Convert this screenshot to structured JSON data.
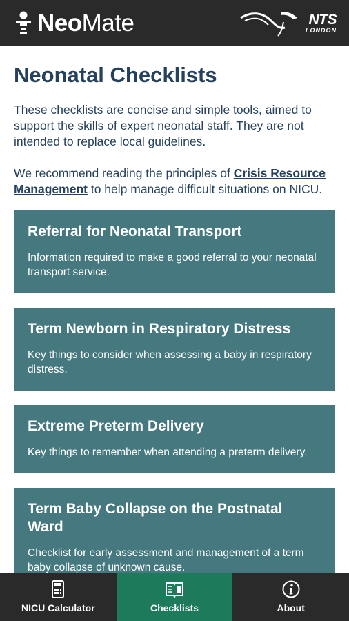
{
  "header": {
    "brand_bold": "Neo",
    "brand_rest": "Mate",
    "partner_name": "NTS",
    "partner_sub": "LONDON"
  },
  "page": {
    "title": "Neonatal Checklists",
    "intro": "These checklists are concise and simple tools, aimed to support the skills of expert neonatal staff. They are not intended to replace local guidelines.",
    "recommend_prefix": "We recommend reading the principles of ",
    "recommend_link": "Crisis Resource Management",
    "recommend_suffix": " to help manage difficult situations on NICU."
  },
  "checklists": [
    {
      "title": "Referral for Neonatal Transport",
      "description": "Information required to make a good referral to your neonatal transport service."
    },
    {
      "title": "Term Newborn in Respiratory Distress",
      "description": "Key things to consider when assessing a baby in respiratory distress."
    },
    {
      "title": "Extreme Preterm Delivery",
      "description": "Key things to remember when attending a preterm delivery."
    },
    {
      "title": "Term Baby Collapse on the Postnatal Ward",
      "description": "Checklist for early assessment and management of a term baby collapse of unknown cause."
    }
  ],
  "nav": {
    "items": [
      {
        "label": "NICU Calculator",
        "icon": "calculator-icon"
      },
      {
        "label": "Checklists",
        "icon": "checklist-book-icon",
        "active": true
      },
      {
        "label": "About",
        "icon": "info-icon"
      }
    ]
  },
  "colors": {
    "header_bg": "#2a2a2a",
    "title_color": "#26415c",
    "card_bg": "#46787f",
    "active_nav_bg": "#1d7a5a"
  }
}
